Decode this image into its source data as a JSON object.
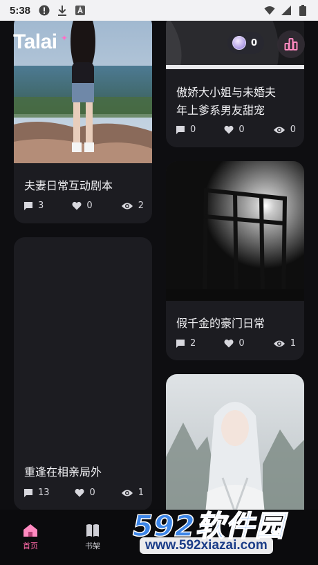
{
  "status_bar": {
    "time": "5:38",
    "left_icons": [
      "alert-circle-icon",
      "download-icon",
      "a-box-icon"
    ],
    "right_icons": [
      "wifi-icon",
      "signal-icon",
      "battery-icon"
    ]
  },
  "header": {
    "logo": "Talai",
    "coin_count": "0"
  },
  "feed": {
    "left": [
      {
        "title": "夫妻日常互动剧本",
        "comments": "3",
        "likes": "0",
        "views": "2"
      },
      {
        "title": "重逢在相亲局外",
        "comments": "13",
        "likes": "0",
        "views": "1"
      }
    ],
    "right": [
      {
        "title_line1": "傲娇大小姐与未婚夫",
        "title_line2": "年上爹系男友甜宠",
        "comments": "0",
        "likes": "0",
        "views": "0"
      },
      {
        "title": "假千金的豪门日常",
        "comments": "2",
        "likes": "0",
        "views": "1"
      }
    ]
  },
  "nav": {
    "home_label": "首页",
    "shelf_label": "书架"
  },
  "watermark": {
    "brand": "592软件园",
    "url": "www.592xiazai.com"
  },
  "colors": {
    "accent": "#ff6aa8",
    "background": "#0e0e11",
    "card": "#1c1c21"
  }
}
